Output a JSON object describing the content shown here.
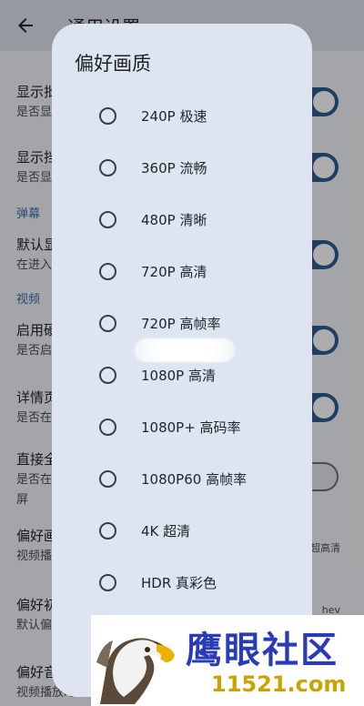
{
  "appbar": {
    "title": "通用设置"
  },
  "settings": {
    "row1": {
      "title": "显示批",
      "subtitle": "是否显"
    },
    "row2": {
      "title": "显示挡",
      "subtitle": "是否显"
    },
    "section_danmaku": "弹幕",
    "row3": {
      "title": "默认显",
      "subtitle": "在进入"
    },
    "section_video": "视频",
    "row4": {
      "title": "启用硬",
      "subtitle": "是否启"
    },
    "row5": {
      "title": "详情页",
      "subtitle": "是否在"
    },
    "row6": {
      "title": "直接全",
      "subtitle": "是否在",
      "subtitle2": "屏"
    },
    "row7": {
      "title": "偏好画",
      "subtitle": "视频播",
      "trailing": "超高清"
    },
    "row8": {
      "title": "偏好初",
      "subtitle": "默认偏",
      "trailing": "hev"
    },
    "row9": {
      "title": "偏好音",
      "subtitle": "视频播放时默"
    }
  },
  "dialog": {
    "title": "偏好画质",
    "options": [
      {
        "label": "240P 极速"
      },
      {
        "label": "360P 流畅"
      },
      {
        "label": "480P 清晰"
      },
      {
        "label": "720P 高清"
      },
      {
        "label": "720P 高帧率"
      },
      {
        "label": "1080P 高清"
      },
      {
        "label": "1080P+ 高码率"
      },
      {
        "label": "1080P60 高帧率"
      },
      {
        "label": "4K 超清"
      },
      {
        "label": "HDR 真彩色"
      }
    ]
  },
  "watermark": {
    "brand": "鹰眼社区",
    "domain": "11521.com"
  },
  "icons": {
    "back": "arrow-back-icon",
    "logo": "eagle-logo-icon"
  },
  "colors": {
    "accent": "#2d5d91",
    "dialog_bg": "#dee5f0",
    "section": "#3f6da8"
  }
}
